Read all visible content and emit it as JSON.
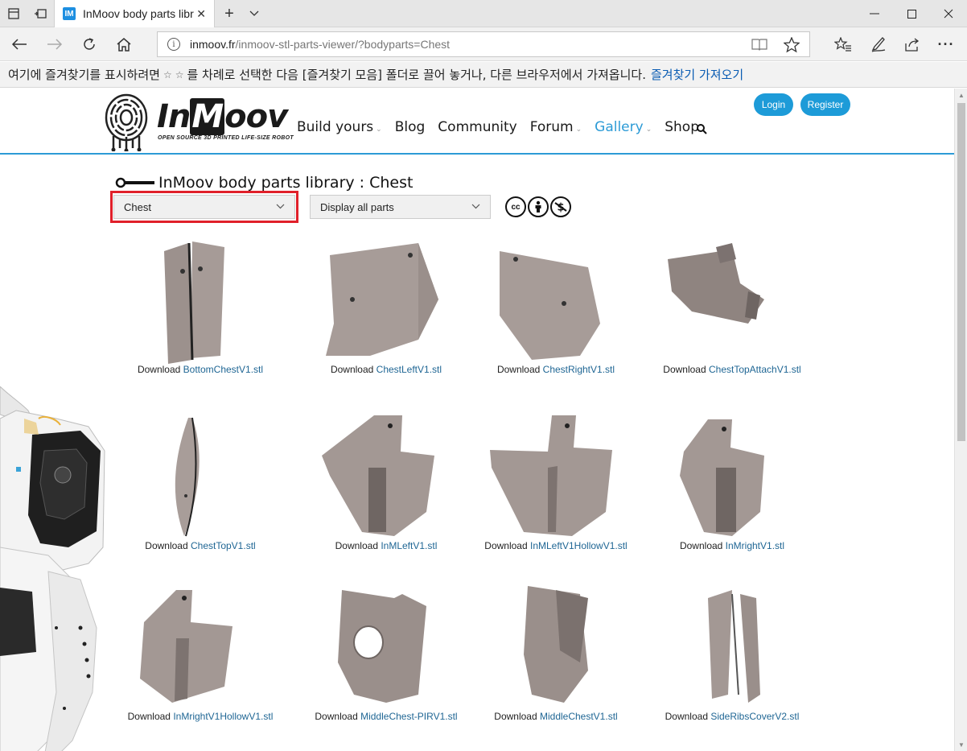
{
  "browser": {
    "tab_title": "InMoov body parts libra",
    "tab_favicon": "IM",
    "address_host": "inmoov.fr",
    "address_path": "/inmoov-stl-parts-viewer/?bodyparts=Chest",
    "favorites_prompt": "여기에 즐겨찾기를 표시하려면",
    "favorites_middle": "를 차례로 선택한 다음 [즐겨찾기 모음] 폴더로 끌어 놓거나, 다른 브라우저에서 가져옵니다.",
    "favorites_link": "즐겨찾기 가져오기"
  },
  "site": {
    "logo_text_a": "In",
    "logo_text_m": "M",
    "logo_text_b": "oov",
    "logo_subtitle": "OPEN SOURCE 3D PRINTED LIFE-SIZE ROBOT",
    "menu": [
      {
        "label": "Build yours",
        "has_caret": true
      },
      {
        "label": "Blog",
        "has_caret": false
      },
      {
        "label": "Community",
        "has_caret": false
      },
      {
        "label": "Forum",
        "has_caret": true
      },
      {
        "label": "Gallery",
        "has_caret": true,
        "active": true
      },
      {
        "label": "Shop",
        "has_caret": false
      }
    ],
    "login_label": "Login",
    "register_label": "Register",
    "accent_color": "#2d9bd6"
  },
  "library": {
    "title": "InMoov body parts library : Chest",
    "bodypart_select": "Chest",
    "display_select": "Display all parts",
    "license_icons": [
      "cc",
      "by",
      "nc"
    ]
  },
  "parts": [
    {
      "prefix": "Download ",
      "file": "BottomChestV1.stl"
    },
    {
      "prefix": "Download ",
      "file": "ChestLeftV1.stl"
    },
    {
      "prefix": "Download ",
      "file": "ChestRightV1.stl"
    },
    {
      "prefix": "Download ",
      "file": "ChestTopAttachV1.stl"
    },
    {
      "prefix": "Download ",
      "file": "ChestTopV1.stl"
    },
    {
      "prefix": "Download ",
      "file": "InMLeftV1.stl"
    },
    {
      "prefix": "Download ",
      "file": "InMLeftV1HollowV1.stl"
    },
    {
      "prefix": "Download ",
      "file": "InMrightV1.stl"
    },
    {
      "prefix": "Download ",
      "file": "InMrightV1HollowV1.stl"
    },
    {
      "prefix": "Download ",
      "file": "MiddleChest-PIRV1.stl"
    },
    {
      "prefix": "Download ",
      "file": "MiddleChestV1.stl"
    },
    {
      "prefix": "Download ",
      "file": "SideRibsCoverV2.stl"
    }
  ]
}
